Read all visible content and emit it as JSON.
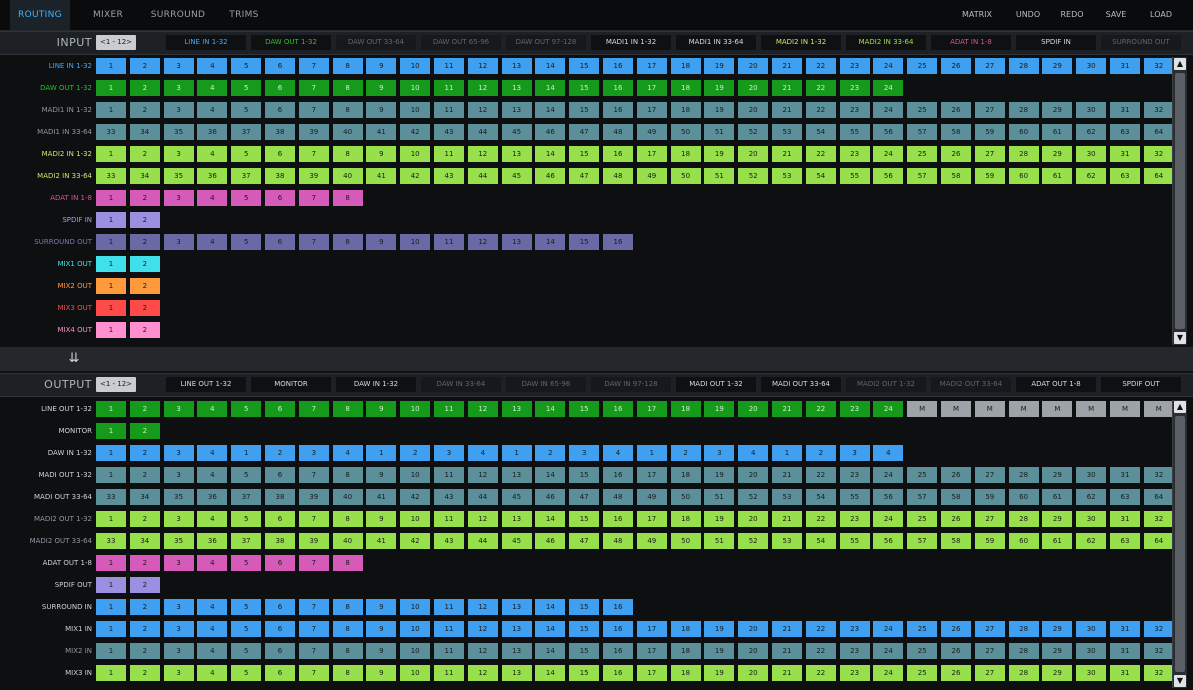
{
  "top_tabs": [
    {
      "label": "ROUTING",
      "active": true
    },
    {
      "label": "MIXER"
    },
    {
      "label": "SURROUND"
    },
    {
      "label": "TRIMS"
    }
  ],
  "top_actions": [
    "MATRIX",
    "UNDO",
    "REDO",
    "SAVE",
    "LOAD"
  ],
  "input": {
    "title": "INPUT",
    "page": "<1 - 12>",
    "tabs": [
      {
        "label": "LINE IN 1-32",
        "color": "#3fa9ff"
      },
      {
        "label": "DAW OUT 1-32",
        "color": "#2cbf2c"
      },
      {
        "label": "DAW OUT 33-64",
        "dim": true
      },
      {
        "label": "DAW OUT 65-96",
        "dim": true
      },
      {
        "label": "DAW OUT 97-128",
        "dim": true
      },
      {
        "label": "MADI1 IN 1-32"
      },
      {
        "label": "MADI1 IN 33-64"
      },
      {
        "label": "MADI2 IN 1-32",
        "color": "#c8e86a"
      },
      {
        "label": "MADI2 IN 33-64",
        "color": "#9fe04a"
      },
      {
        "label": "ADAT IN 1-8",
        "color": "#e2508f"
      },
      {
        "label": "SPDIF IN"
      },
      {
        "label": "SURROUND OUT",
        "dim": true
      }
    ],
    "rows": [
      {
        "label": "LINE IN 1-32",
        "label_color": "#3fa9ff",
        "color": "#3f9ff0",
        "start": 1,
        "count": 32
      },
      {
        "label": "DAW OUT 1-32",
        "label_color": "#2cbf2c",
        "color": "#159a1c",
        "start": 1,
        "count": 24,
        "dark": true
      },
      {
        "label": "MADI1 IN 1-32",
        "label_color": "#8f98a0",
        "color": "#5b8f99",
        "start": 1,
        "count": 32
      },
      {
        "label": "MADI1 IN 33-64",
        "label_color": "#8f98a0",
        "color": "#5b8f99",
        "start": 33,
        "count": 32
      },
      {
        "label": "MADI2 IN 1-32",
        "label_color": "#c8e86a",
        "color": "#97e04c",
        "start": 1,
        "count": 32
      },
      {
        "label": "MADI2 IN 33-64",
        "label_color": "#c8e86a",
        "color": "#97e04c",
        "start": 33,
        "count": 32
      },
      {
        "label": "ADAT IN 1-8",
        "label_color": "#e2508f",
        "color": "#d65bb8",
        "start": 1,
        "count": 8
      },
      {
        "label": "SPDIF IN",
        "label_color": "#a89be8",
        "color": "#9b8fe0",
        "start": 1,
        "count": 2
      },
      {
        "label": "SURROUND OUT",
        "label_color": "#7d7aa8",
        "color": "#6b68a6",
        "start": 1,
        "count": 16
      },
      {
        "label": "MIX1 OUT",
        "label_color": "#40e0e8",
        "color": "#3fe0ea",
        "start": 1,
        "count": 2
      },
      {
        "label": "MIX2 OUT",
        "label_color": "#ff9a3c",
        "color": "#ff9a3c",
        "start": 1,
        "count": 2
      },
      {
        "label": "MIX3 OUT",
        "label_color": "#ff4a4a",
        "color": "#ff4a4a",
        "start": 1,
        "count": 2
      },
      {
        "label": "MIX4 OUT",
        "label_color": "#ff8fd0",
        "color": "#ff8fd0",
        "start": 1,
        "count": 2
      }
    ]
  },
  "output": {
    "title": "OUTPUT",
    "page": "<1 - 12>",
    "tabs": [
      {
        "label": "LINE OUT 1-32"
      },
      {
        "label": "MONITOR"
      },
      {
        "label": "DAW IN 1-32"
      },
      {
        "label": "DAW IN 33-64",
        "dim": true
      },
      {
        "label": "DAW IN 65-96",
        "dim": true
      },
      {
        "label": "DAW IN 97-128",
        "dim": true
      },
      {
        "label": "MADI OUT 1-32"
      },
      {
        "label": "MADI OUT 33-64"
      },
      {
        "label": "MADI2 OUT 1-32",
        "dim": true
      },
      {
        "label": "MADI2 OUT 33-64",
        "dim": true
      },
      {
        "label": "ADAT OUT 1-8"
      },
      {
        "label": "SPDIF OUT"
      }
    ],
    "rows": [
      {
        "label": "LINE OUT 1-32",
        "label_color": "#cfd3d6",
        "color": "#159a1c",
        "start": 1,
        "count": 24,
        "dark": true,
        "extra": {
          "count": 8,
          "text": "M",
          "color": "#9da3a8"
        }
      },
      {
        "label": "MONITOR",
        "label_color": "#cfd3d6",
        "color": "#159a1c",
        "start": 1,
        "count": 2,
        "dark": true
      },
      {
        "label": "DAW IN 1-32",
        "label_color": "#cfd3d6",
        "color": "#3f9ff0",
        "values": [
          1,
          2,
          3,
          4,
          1,
          2,
          3,
          4,
          1,
          2,
          3,
          4,
          1,
          2,
          3,
          4,
          1,
          2,
          3,
          4,
          1,
          2,
          3,
          4
        ]
      },
      {
        "label": "MADI OUT 1-32",
        "label_color": "#cfd3d6",
        "color": "#5b8f99",
        "start": 1,
        "count": 32
      },
      {
        "label": "MADI OUT 33-64",
        "label_color": "#cfd3d6",
        "color": "#5b8f99",
        "start": 33,
        "count": 32
      },
      {
        "label": "MADI2 OUT 1-32",
        "label_color": "#8f98a0",
        "color": "#97e04c",
        "start": 1,
        "count": 32
      },
      {
        "label": "MADI2 OUT 33-64",
        "label_color": "#8f98a0",
        "color": "#97e04c",
        "start": 33,
        "count": 32
      },
      {
        "label": "ADAT OUT 1-8",
        "label_color": "#cfd3d6",
        "color": "#d65bb8",
        "start": 1,
        "count": 8
      },
      {
        "label": "SPDIF OUT",
        "label_color": "#cfd3d6",
        "color": "#9b8fe0",
        "start": 1,
        "count": 2
      },
      {
        "label": "SURROUND IN",
        "label_color": "#cfd3d6",
        "color": "#3f9ff0",
        "start": 1,
        "count": 16
      },
      {
        "label": "MIX1 IN",
        "label_color": "#cfd3d6",
        "color": "#3f9ff0",
        "start": 1,
        "count": 32
      },
      {
        "label": "MIX2 IN",
        "label_color": "#8f98a0",
        "color": "#5b8f99",
        "start": 1,
        "count": 32
      },
      {
        "label": "MIX3 IN",
        "label_color": "#cfd3d6",
        "color": "#97e04c",
        "start": 1,
        "count": 32
      }
    ]
  },
  "icons": {
    "collapse": "double-chevron-down-icon",
    "scroll_up": "arrow-up-icon",
    "scroll_down": "arrow-down-icon"
  }
}
